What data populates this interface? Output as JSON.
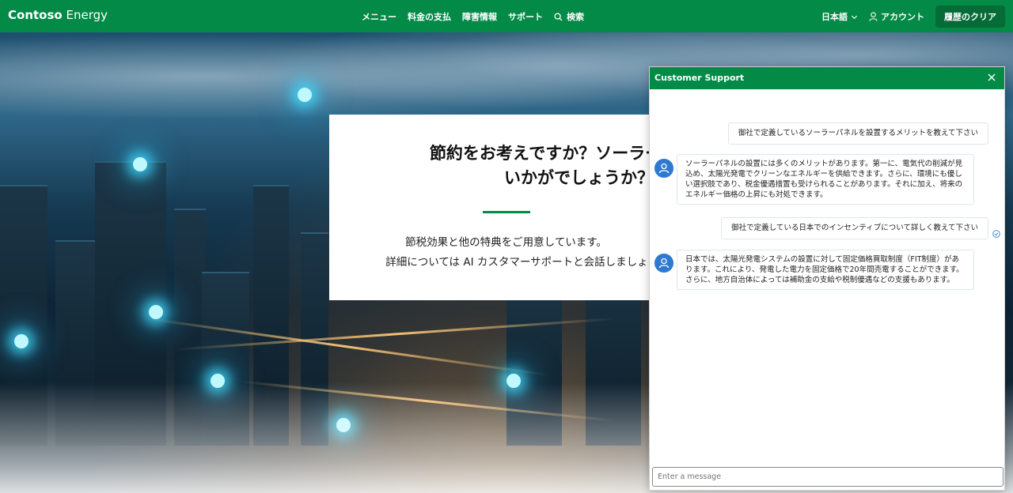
{
  "header": {
    "brand_bold": "Contoso",
    "brand_light": "Energy",
    "nav": [
      {
        "label": "メニュー"
      },
      {
        "label": "料金の支払"
      },
      {
        "label": "障害情報"
      },
      {
        "label": "サポート"
      },
      {
        "label": "検索",
        "icon": "search-icon"
      }
    ],
    "language": "日本語",
    "account": "アカウント",
    "clear_history": "履歴のクリア"
  },
  "hero": {
    "headline_line1": "節約をお考えですか？ソーラーパネルは",
    "headline_line2": "いかがでしょうか？",
    "subtitle_line1": "節税効果と他の特典をご用意しています。",
    "subtitle_line2": "詳細については AI カスタマーサポートと会話しましょう。",
    "accent_color": "#038a47"
  },
  "chat": {
    "title": "Customer Support",
    "messages": [
      {
        "role": "user",
        "text": "御社で定義しているソーラーパネルを設置するメリットを教えて下さい"
      },
      {
        "role": "assistant",
        "text": "ソーラーパネルの設置には多くのメリットがあります。第一に、電気代の削減が見込め、太陽光発電でクリーンなエネルギーを供給できます。さらに、環境にも優しい選択肢であり、税金優遇措置も受けられることがあります。それに加え、将来のエネルギー価格の上昇にも対処できます。"
      },
      {
        "role": "user",
        "text": "御社で定義している日本でのインセンティブについて詳しく教えて下さい"
      },
      {
        "role": "assistant",
        "text": "日本では、太陽光発電システムの設置に対して固定価格買取制度（FIT制度）があります。これにより、発電した電力を固定価格で20年間売電することができます。さらに、地方自治体によっては補助金の支給や税制優遇などの支援もあります。"
      }
    ],
    "input_placeholder": "Enter a message"
  },
  "colors": {
    "header_bg": "#038a47",
    "clear_button_bg": "#056c38",
    "avatar_bg": "#2e7ad1"
  }
}
